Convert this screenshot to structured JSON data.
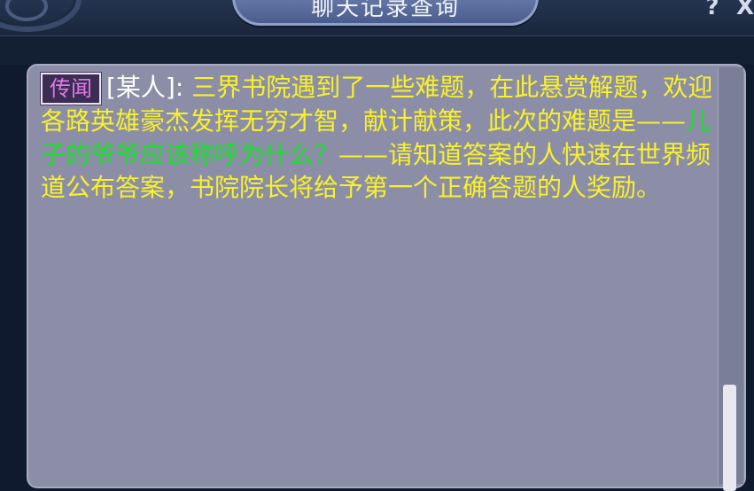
{
  "window": {
    "title": "聊天记录查询",
    "help_label": "?",
    "close_label": "X"
  },
  "message": {
    "channel_badge": "传闻",
    "speaker": "[某人]:",
    "text_part1": " 三界书院遇到了一些难题，在此悬赏解题，欢迎各路英雄豪杰发挥无穷才智，献计献策，此次的难题是——",
    "question": "儿子的爷爷应该称呼为什么？",
    "text_part2": "——请知道答案的人快速在世界频道公布答案，书院院长将给予第一个正确答题的人奖励。"
  },
  "colors": {
    "message_text": "#f8f12c",
    "question_text": "#19e02a",
    "speaker_text": "#ffffff",
    "badge_text": "#e07ae8",
    "panel_bg": "#8b8ea6"
  }
}
